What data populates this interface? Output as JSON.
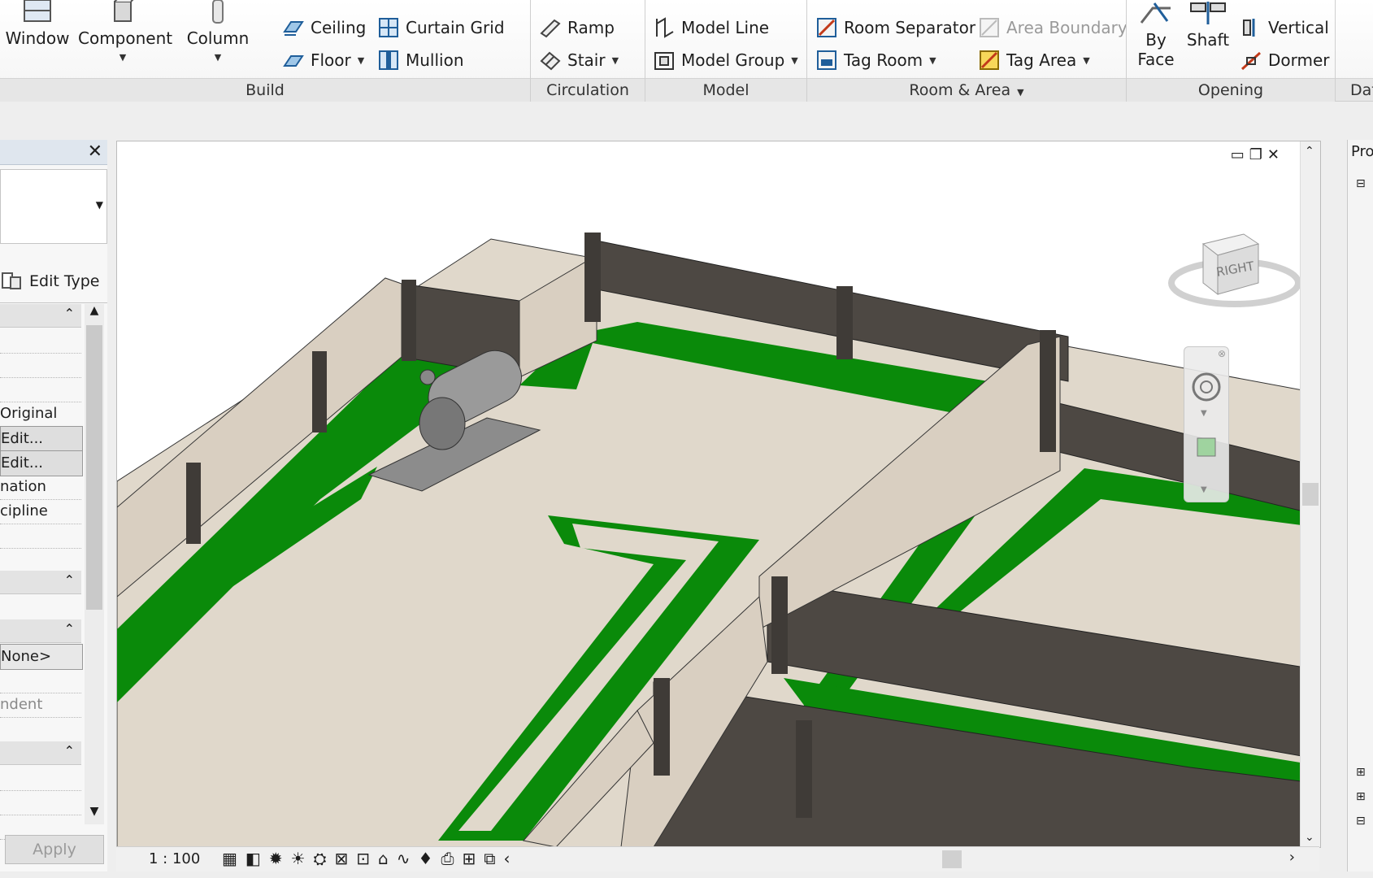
{
  "ribbon": {
    "build": {
      "title": "Build",
      "window_label": "Window",
      "component_label": "Component",
      "column_label": "Column",
      "ceiling_label": "Ceiling",
      "floor_label": "Floor",
      "curtain_grid_label": "Curtain Grid",
      "mullion_label": "Mullion"
    },
    "circulation": {
      "title": "Circulation",
      "ramp_label": "Ramp",
      "stair_label": "Stair"
    },
    "model": {
      "title": "Model",
      "model_line_label": "Model Line",
      "model_group_label": "Model Group"
    },
    "room_area": {
      "title": "Room & Area",
      "room_separator_label": "Room Separator",
      "area_boundary_label": "Area Boundary",
      "tag_room_label": "Tag Room",
      "tag_area_label": "Tag Area"
    },
    "opening": {
      "title": "Opening",
      "by_face_line1": "By",
      "by_face_line2": "Face",
      "shaft_label": "Shaft",
      "vertical_label": "Vertical",
      "dormer_label": "Dormer"
    },
    "datum": {
      "title_partial": "Dat"
    }
  },
  "properties": {
    "close_glyph": "✕",
    "edit_type_label": "Edit Type",
    "rows": [
      {
        "text": "Original",
        "kind": "text"
      },
      {
        "text": "Edit...",
        "kind": "button"
      },
      {
        "text": "Edit...",
        "kind": "button"
      },
      {
        "text": "nation",
        "kind": "text"
      },
      {
        "text": "cipline",
        "kind": "text"
      },
      {
        "text": "None>",
        "kind": "field"
      },
      {
        "text": "ndent",
        "kind": "dim"
      }
    ],
    "apply_label": "Apply"
  },
  "view": {
    "scale_label": "1 : 100",
    "viewcube_label": "RIGHT",
    "colors": {
      "floor": "#e0d8cb",
      "room_green": "#0a8a0a",
      "wall_dark": "#4d4843",
      "wall_light": "#d9cfc1"
    }
  },
  "project_browser": {
    "title_partial": "Pro"
  }
}
